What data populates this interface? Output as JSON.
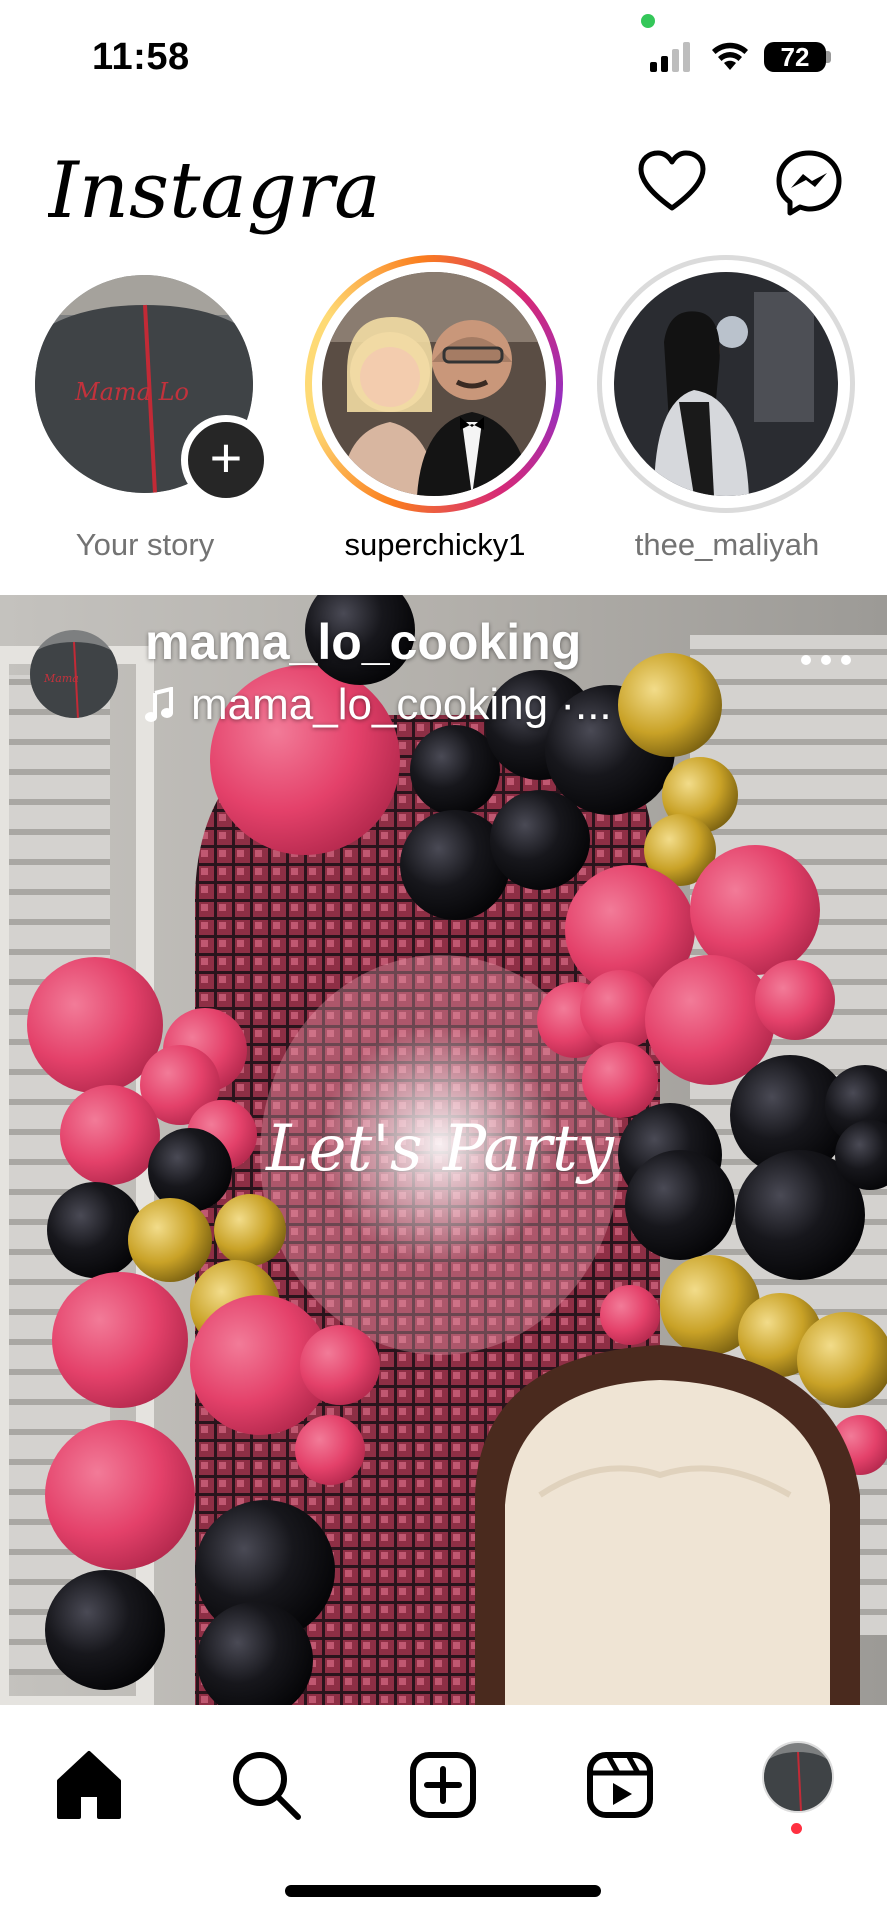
{
  "status_bar": {
    "time": "11:58",
    "battery": "72",
    "colors": {
      "privacy_dot": "#34c759"
    },
    "icons": [
      "signal-icon",
      "wifi-icon",
      "battery-icon"
    ]
  },
  "header": {
    "logo_text": "Instagram",
    "icons": [
      "heart-icon",
      "messenger-icon"
    ]
  },
  "stories": [
    {
      "label": "Your story",
      "own": true,
      "seen": false
    },
    {
      "label": "superchicky1",
      "own": false,
      "seen": false
    },
    {
      "label": "thee_maliyah",
      "own": false,
      "seen": true
    }
  ],
  "post": {
    "username": "mama_lo_cooking",
    "audio": "mama_lo_cooking ·...",
    "sign_text": "Let's Party",
    "icons": [
      "music-note-icon",
      "more-options-icon"
    ]
  },
  "tabbar": {
    "icons": [
      "home-icon",
      "search-icon",
      "create-icon",
      "reels-icon",
      "profile-avatar"
    ],
    "colors": {
      "notification_dot": "#ff3040"
    }
  },
  "colors": {
    "story_gradient": [
      "#feda75",
      "#fa7e1e",
      "#d62976",
      "#962fbf"
    ],
    "seen_ring": "#dbdbdb",
    "muted_text": "#737373",
    "balloon_pink": "#e8436b",
    "balloon_black": "#141418",
    "balloon_gold": "#c9a227"
  }
}
